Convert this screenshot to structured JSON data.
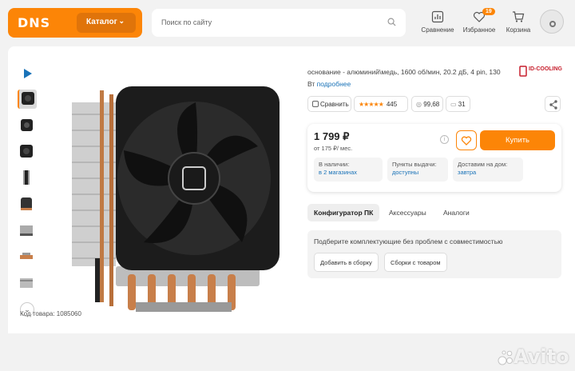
{
  "header": {
    "logo": "DNS",
    "catalog_label": "Каталог",
    "search_placeholder": "Поиск по сайту",
    "items": [
      {
        "label": "Сравнение",
        "icon": "chart-icon"
      },
      {
        "label": "Избранное",
        "icon": "heart-icon",
        "badge": "19"
      },
      {
        "label": "Корзина",
        "icon": "cart-icon"
      }
    ],
    "accent_color": "#fc8507"
  },
  "gallery": {
    "thumb_count": 9,
    "product_code": "Код товара: 1085060"
  },
  "product": {
    "description": "основание - алюминий\\медь, 1600 об/мин, 20.2 дБ, 4 pin, 130",
    "description_tail": "Вт",
    "more_link": "подробнее",
    "brand": "ID-COOLING",
    "compare_label": "Сравнить",
    "rating_count": "445",
    "reliability": "99,68",
    "comments": "31"
  },
  "price_box": {
    "price": "1 799 ₽",
    "credit": "от 175 ₽/ мес.",
    "buy_label": "Купить",
    "availability": [
      {
        "label": "В наличии:",
        "value": "в 2 магазинах"
      },
      {
        "label": "Пункты выдачи:",
        "value": "доступны"
      },
      {
        "label": "Доставим на дом:",
        "value": "завтра"
      }
    ]
  },
  "tabs": [
    "Конфигуратор ПК",
    "Аксессуары",
    "Аналоги"
  ],
  "configurator": {
    "text": "Подберите комплектующие без проблем с совместимостью",
    "add_label": "Добавить в сборку",
    "builds_label": "Сборки с товаром"
  },
  "watermark": "Avito"
}
